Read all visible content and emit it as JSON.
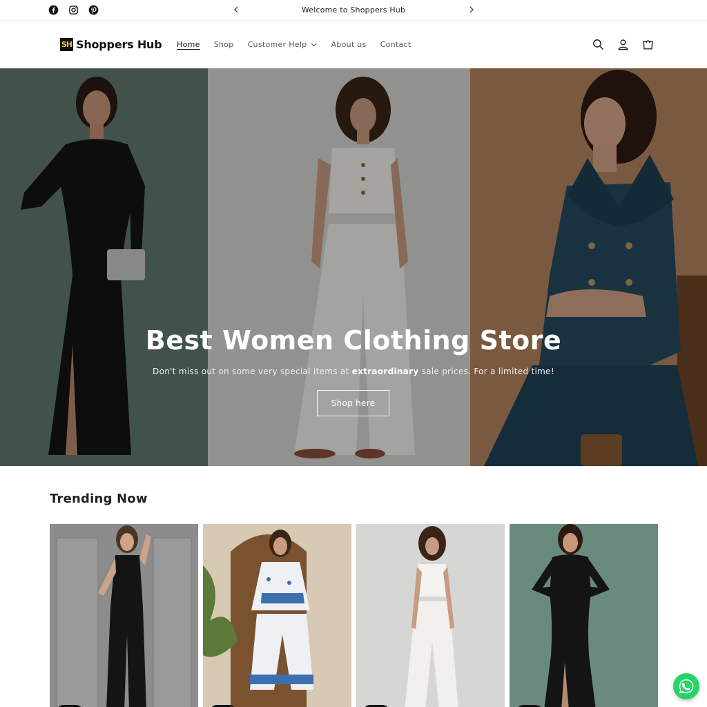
{
  "announcement": {
    "text": "Welcome to Shoppers Hub",
    "social_icons": [
      "facebook-icon",
      "instagram-icon",
      "pinterest-icon"
    ]
  },
  "header": {
    "logo_mark": "SH",
    "logo_text": "Shoppers Hub",
    "nav": [
      {
        "label": "Home",
        "active": true
      },
      {
        "label": "Shop",
        "active": false
      },
      {
        "label": "Customer Help",
        "active": false,
        "dropdown": true
      },
      {
        "label": "About us",
        "active": false
      },
      {
        "label": "Contact",
        "active": false
      }
    ],
    "icons": [
      "search-icon",
      "account-icon",
      "cart-icon"
    ]
  },
  "hero": {
    "title": "Best Women Clothing Store",
    "subtitle_before": "Don't miss out on some very special items at ",
    "subtitle_bold": "extraordinary",
    "subtitle_after": " sale prices. For a limited time!",
    "button_label": "Shop here"
  },
  "trending": {
    "title": "Trending Now",
    "products": [
      {
        "image": "black-jumpsuit-photo"
      },
      {
        "image": "printed-coord-set-photo"
      },
      {
        "image": "white-cargo-set-photo"
      },
      {
        "image": "black-maxi-dress-photo"
      }
    ]
  },
  "colors": {
    "accent": "#121212",
    "whatsapp": "#25d366"
  }
}
